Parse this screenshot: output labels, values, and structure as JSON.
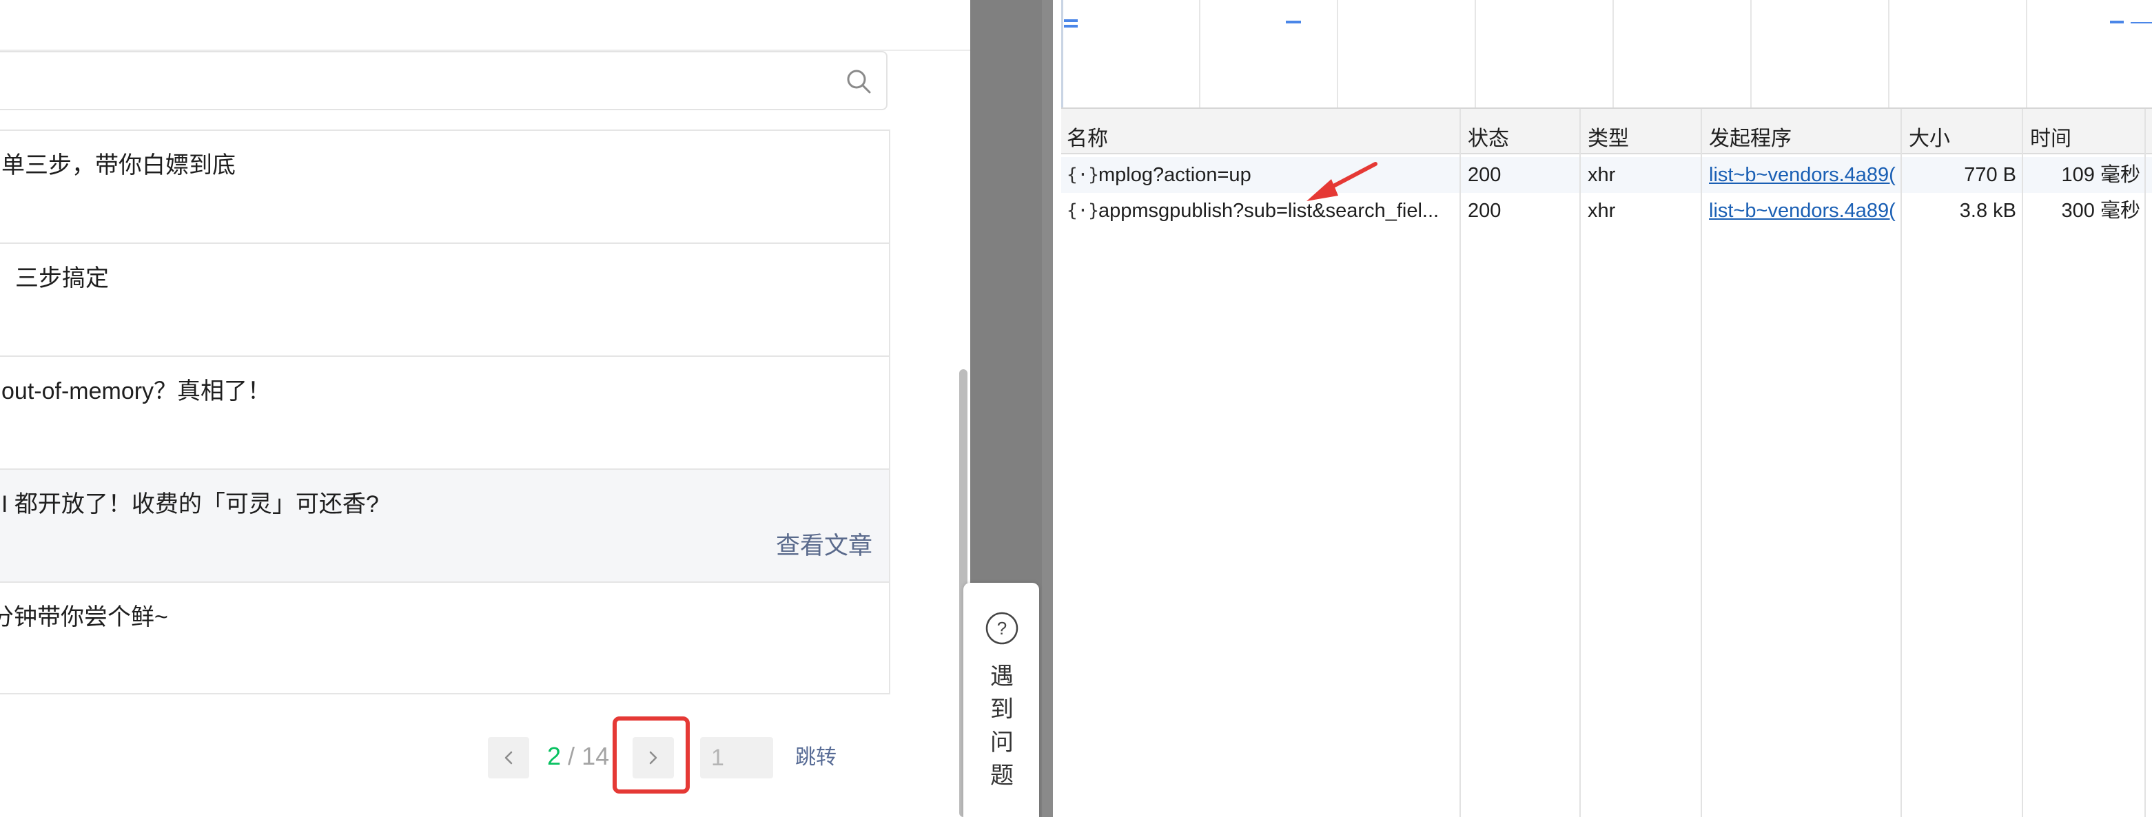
{
  "articles": {
    "items": [
      {
        "title": "单三步，带你白嫖到底"
      },
      {
        "title": "三步搞定"
      },
      {
        "title": "out-of-memory？真相了！"
      },
      {
        "title": "I 都开放了！收费的「可灵」可还香?",
        "action_label": "查看文章"
      },
      {
        "title": "分钟带你尝个鲜~"
      }
    ]
  },
  "pagination": {
    "current": "2",
    "separator": "/",
    "total": "14",
    "input_placeholder": "1",
    "jump_label": "跳转"
  },
  "help": {
    "label": "遇到问题",
    "icon": "question-circle-icon"
  },
  "network": {
    "columns": {
      "name": "名称",
      "status": "状态",
      "type": "类型",
      "initiator": "发起程序",
      "size": "大小",
      "time": "时间"
    },
    "rows": [
      {
        "name": "mplog?action=up",
        "status": "200",
        "type": "xhr",
        "initiator": "list~b~vendors.4a89(",
        "size": "770 B",
        "time": "109 毫秒"
      },
      {
        "name": "appmsgpublish?sub=list&search_fiel...",
        "status": "200",
        "type": "xhr",
        "initiator": "list~b~vendors.4a89(",
        "size": "3.8 kB",
        "time": "300 毫秒"
      }
    ]
  },
  "colors": {
    "accent_green": "#07c160",
    "link_blue": "#1a5fb4",
    "highlight_red": "#e53935",
    "wechat_link": "#576b95"
  }
}
